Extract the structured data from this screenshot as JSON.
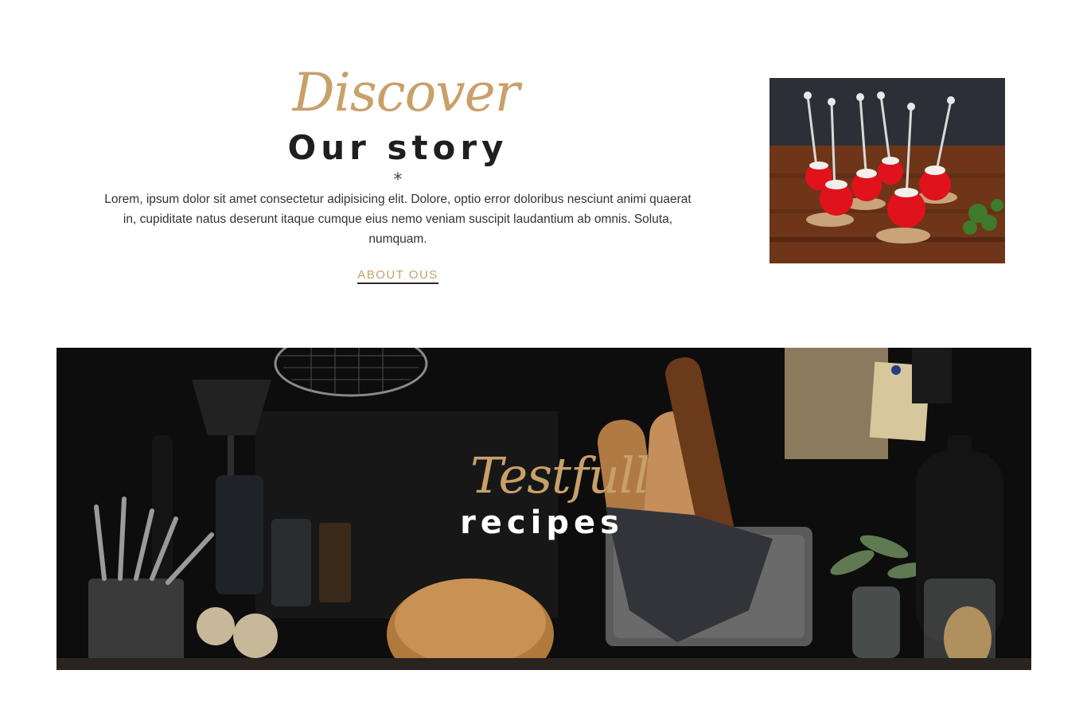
{
  "about": {
    "script_title": "Discover",
    "title": "Our story",
    "divider_symbol": "*",
    "body": "Lorem, ipsum dolor sit amet consectetur adipisicing elit. Dolore, optio error doloribus nesciunt animi quaerat in, cupiditate natus deserunt itaque cumque eius nemo veniam suscipit laudantium ab omnis. Soluta, numquam.",
    "link_label": "ABOUT OUS",
    "photo_icon": "tomato-skewers-photo"
  },
  "banner": {
    "script_title": "Testfull",
    "title": "recipes",
    "photo_icon": "kitchen-bread-photo"
  },
  "colors": {
    "accent": "#c8a06a",
    "heading": "#1f1f1f",
    "body_text": "#333333",
    "background": "#ffffff"
  }
}
